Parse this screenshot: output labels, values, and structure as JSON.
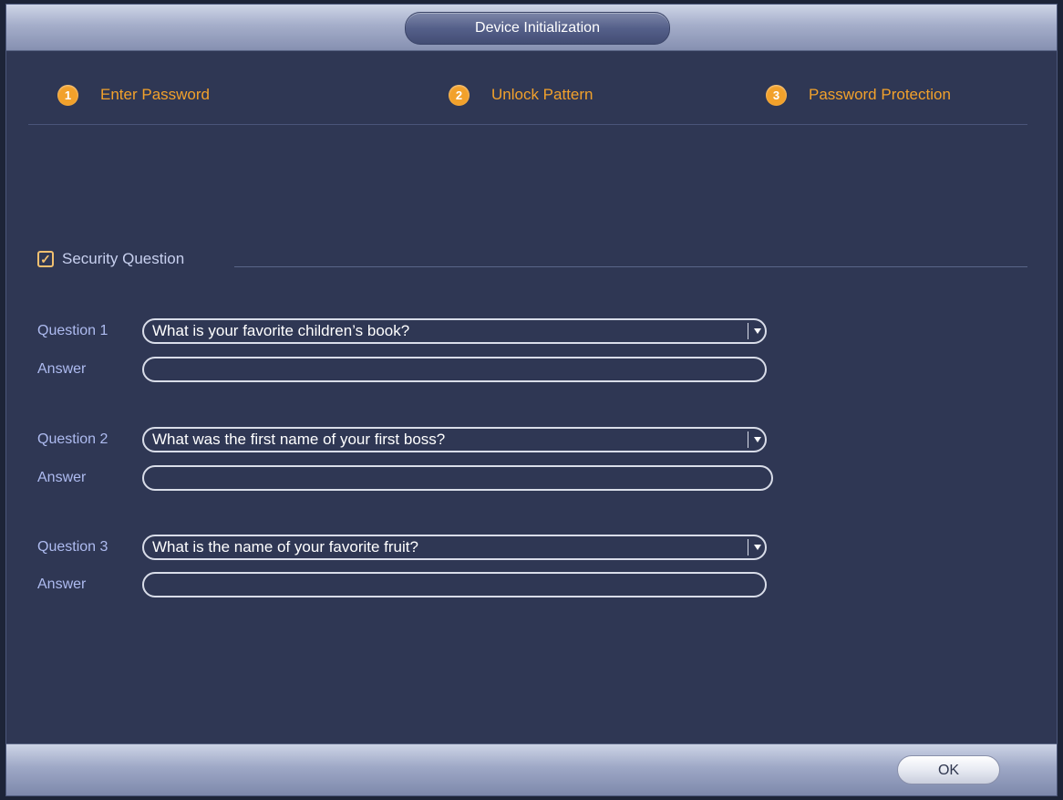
{
  "window": {
    "title": "Device Initialization"
  },
  "steps": [
    {
      "number": "1",
      "label": "Enter Password"
    },
    {
      "number": "2",
      "label": "Unlock Pattern"
    },
    {
      "number": "3",
      "label": "Password Protection"
    }
  ],
  "security": {
    "checkbox_checked": true,
    "label": "Security Question"
  },
  "questions": [
    {
      "label": "Question 1",
      "selected": "What is your favorite children’s book?",
      "answer_label": "Answer",
      "answer_value": ""
    },
    {
      "label": "Question 2",
      "selected": "What was the first name of your first boss?",
      "answer_label": "Answer",
      "answer_value": ""
    },
    {
      "label": "Question 3",
      "selected": "What is the name of your favorite fruit?",
      "answer_label": "Answer",
      "answer_value": ""
    }
  ],
  "footer": {
    "ok_label": "OK"
  },
  "colors": {
    "accent": "#f2a12b",
    "panel_bg": "#2f3754",
    "label_text": "#aebbf0"
  }
}
